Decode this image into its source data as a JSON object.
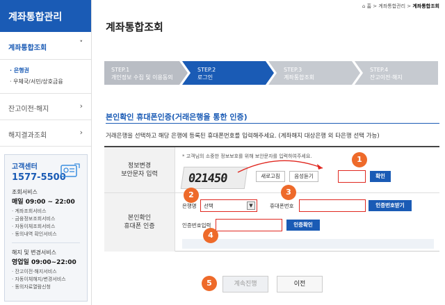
{
  "sidebar": {
    "title": "계좌통합관리",
    "active_menu": "계좌통합조회",
    "active_chevron": "˅",
    "sub_items": [
      "· 은행권",
      "· 우체국/서민/상호금융"
    ],
    "menus": [
      {
        "label": "잔고이전·해지",
        "chevron": "›"
      },
      {
        "label": "해지결과조회",
        "chevron": "›"
      }
    ]
  },
  "customer_center": {
    "title": "고객센터",
    "phone": "1577-5500",
    "section1_title": "조회서비스",
    "section1_time": "매일 09:00 ~ 22:00",
    "section1_items": [
      "· 계좌조회서비스",
      "· 금융정보조회서비스",
      "· 자동이체조회서비스",
      "· 동의내역 확인서비스"
    ],
    "section2_title": "해지 및 변경서비스",
    "section2_time": "영업일 09:00~22:00",
    "section2_items": [
      "· 잔고이전·해지서비스",
      "· 자동이체해지/변경서비스",
      "· 동의자료열람신청"
    ],
    "icon": "contact-card-icon"
  },
  "breadcrumb": {
    "home": "⌂ 홈",
    "sep": ">",
    "level1": "계좌통합관리",
    "level2": "계좌통합조회"
  },
  "page_title": "계좌통합조회",
  "steps": [
    {
      "step": "STEP.1",
      "label": "개인정보 수집 및 이용동의",
      "state": "done"
    },
    {
      "step": "STEP.2",
      "label": "로그인",
      "state": "active"
    },
    {
      "step": "STEP.3",
      "label": "계좌통합조회",
      "state": "todo"
    },
    {
      "step": "STEP.4",
      "label": "잔고이전·해지",
      "state": "todo"
    }
  ],
  "section": {
    "title": "본인확인 휴대폰인증(거래은행을 통한 인증)",
    "description": "거래은행을 선택하고 해당 은행에 등록된 휴대폰번호를 입력해주세요. (계좌해지 대상은행 외 타은행 선택 가능)"
  },
  "form": {
    "row1_label_line1": "정보변경",
    "row1_label_line2": "보안문자 입력",
    "note": "* 고객님의 소중한 정보보호를 위해 보안문자를 입력하여주세요.",
    "captcha_text": "021450",
    "refresh_label": "새로고침",
    "audio_label": "음성듣기",
    "confirm_label": "확인",
    "row2_label_line1": "본인확인",
    "row2_label_line2": "휴대폰 인증",
    "bank_label": "은행명",
    "bank_value": "선택",
    "phone_label": "휴대폰번호",
    "send_code_label": "인증번호받기",
    "code_label": "인증번호입력",
    "verify_label": "인증확인"
  },
  "badges": [
    "1",
    "2",
    "3",
    "4",
    "5"
  ],
  "buttons": {
    "next": "계속진행",
    "prev": "이전"
  },
  "colors": {
    "primary": "#1a5bb5",
    "highlight": "#e0271f",
    "badge": "#ee6a2a"
  }
}
